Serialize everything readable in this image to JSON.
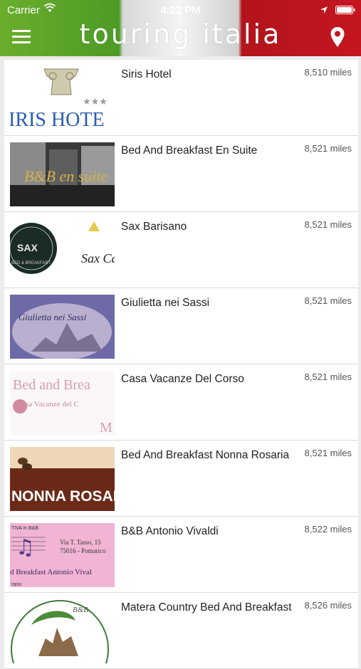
{
  "status": {
    "carrier": "Carrier",
    "time": "4:22 PM"
  },
  "header": {
    "title": "TOURING ITALIA",
    "flag_colors": [
      "#4d9a26",
      "#f4f4f4",
      "#c4161f"
    ]
  },
  "thumbnail_text": {
    "siris": "IRIS HOTE",
    "bb_ensuite": "B&B en suite",
    "sax": "SAX",
    "sax_sub": "BED & BREAKFAST",
    "sax_cafe": "Sax Cafè",
    "giulietta": "Giulietta nei Sassi",
    "casa1": "Bed and Brea",
    "casa2": "Casa Vacanze del C",
    "casa3": "M",
    "nonna": "NONNA ROSAR",
    "vivaldi1": "TIVA in B&B",
    "vivaldi2": "Via T. Tasso, 15",
    "vivaldi3": "75016 - Pomarico",
    "vivaldi4": "d Breakfast Antonio Vival",
    "vivaldi5": "rano",
    "matera": "B&B"
  },
  "items": [
    {
      "name": "Siris Hotel",
      "distance": "8,510 miles"
    },
    {
      "name": "Bed And Breakfast En Suite",
      "distance": "8,521 miles"
    },
    {
      "name": "Sax Barisano",
      "distance": "8,521 miles"
    },
    {
      "name": "Giulietta nei Sassi",
      "distance": "8,521 miles"
    },
    {
      "name": "Casa Vacanze Del Corso",
      "distance": "8,521 miles"
    },
    {
      "name": "Bed And Breakfast Nonna Rosaria",
      "distance": "8,521 miles"
    },
    {
      "name": "B&B Antonio Vivaldi",
      "distance": "8,522 miles"
    },
    {
      "name": "Matera Country Bed And Breakfast",
      "distance": "8,526 miles"
    }
  ]
}
